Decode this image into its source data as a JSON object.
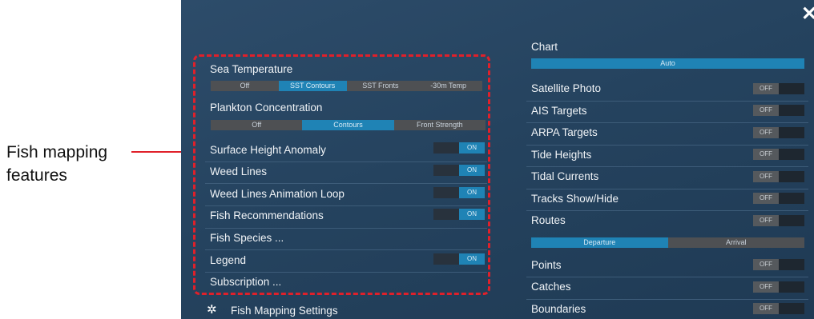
{
  "callout": {
    "line1": "Fish mapping",
    "line2": "features"
  },
  "left_panel": {
    "sea_temperature": {
      "label": "Sea Temperature",
      "options": [
        "Off",
        "SST Contours",
        "SST Fronts",
        "-30m Temp"
      ],
      "active": 1
    },
    "plankton": {
      "label": "Plankton Concentration",
      "options": [
        "Off",
        "Contours",
        "Front Strength"
      ],
      "active": 1
    },
    "toggles": [
      {
        "label": "Surface Height Anomaly",
        "state": "ON"
      },
      {
        "label": "Weed Lines",
        "state": "ON"
      },
      {
        "label": "Weed Lines Animation Loop",
        "state": "ON"
      },
      {
        "label": "Fish Recommendations",
        "state": "ON"
      }
    ],
    "fish_species": "Fish Species ...",
    "legend": {
      "label": "Legend",
      "state": "ON"
    },
    "subscription": "Subscription ..."
  },
  "footer": {
    "settings_label": "Fish Mapping Settings"
  },
  "right_panel": {
    "chart": {
      "label": "Chart",
      "value": "Auto"
    },
    "toggles": [
      {
        "label": "Satellite Photo",
        "state": "OFF"
      },
      {
        "label": "AIS Targets",
        "state": "OFF"
      },
      {
        "label": "ARPA Targets",
        "state": "OFF"
      },
      {
        "label": "Tide Heights",
        "state": "OFF"
      },
      {
        "label": "Tidal Currents",
        "state": "OFF"
      },
      {
        "label": "Tracks Show/Hide",
        "state": "OFF"
      },
      {
        "label": "Routes",
        "state": "OFF"
      }
    ],
    "routes_mode": {
      "options": [
        "Departure",
        "Arrival"
      ],
      "active": 0
    },
    "toggles2": [
      {
        "label": "Points",
        "state": "OFF"
      },
      {
        "label": "Catches",
        "state": "OFF"
      },
      {
        "label": "Boundaries",
        "state": "OFF"
      }
    ]
  },
  "colors": {
    "panel_bg": "#26445f",
    "accent": "#1f83b5",
    "callout_red": "#e0202a"
  }
}
